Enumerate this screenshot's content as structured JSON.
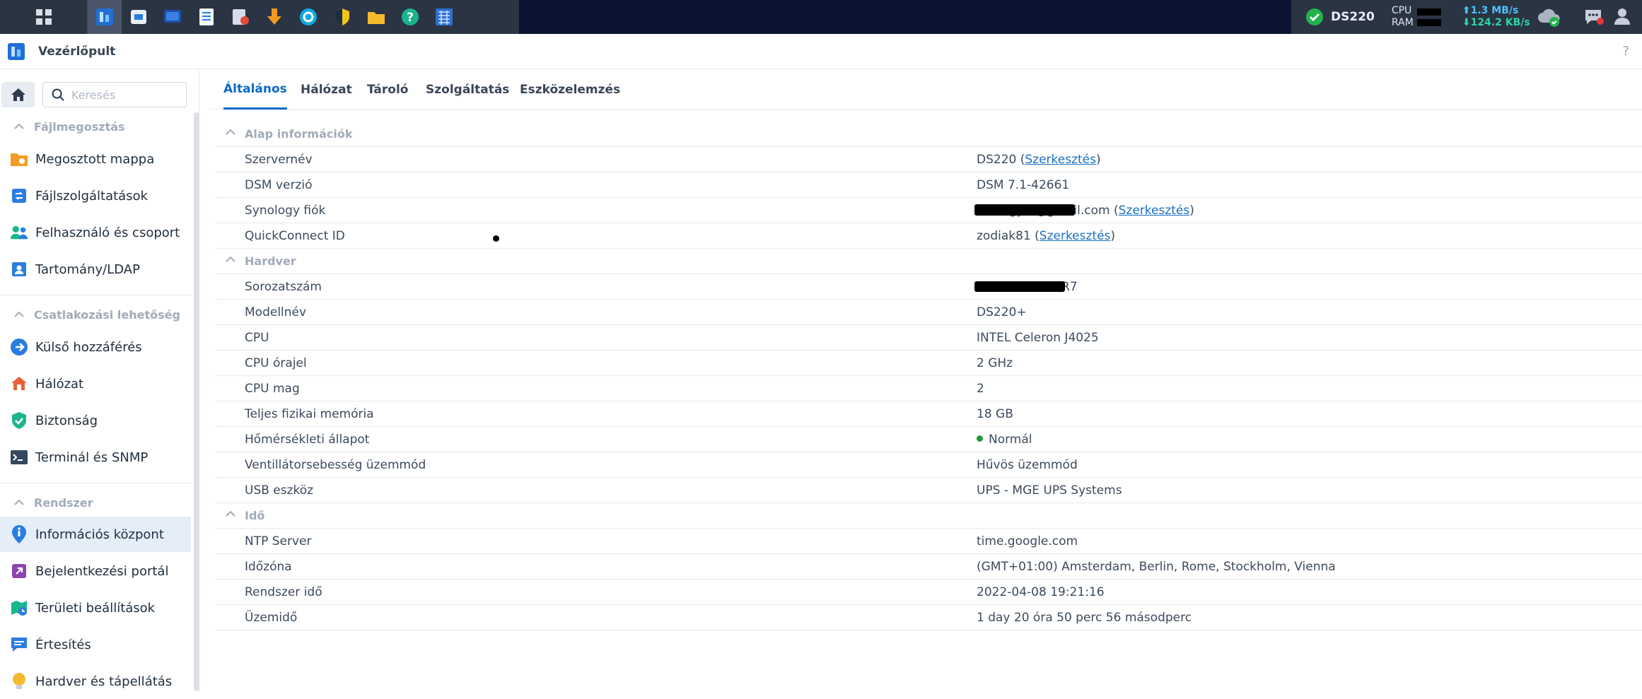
{
  "taskbar": {
    "status_name": "DS220",
    "cpu_label": "CPU",
    "ram_label": "RAM",
    "upload": "1.3 MB/s",
    "download": "124.2 KB/s"
  },
  "window": {
    "title": "Vezérlőpult",
    "help": "?"
  },
  "sidebar": {
    "search_placeholder": "Keresés",
    "sections": [
      {
        "label": "Fájlmegosztás"
      },
      {
        "label": "Csatlakozási lehetőség"
      },
      {
        "label": "Rendszer"
      }
    ],
    "items": [
      {
        "label": "Megosztott mappa"
      },
      {
        "label": "Fájlszolgáltatások"
      },
      {
        "label": "Felhasználó és csoport"
      },
      {
        "label": "Tartomány/LDAP"
      },
      {
        "label": "Külső hozzáférés"
      },
      {
        "label": "Hálózat"
      },
      {
        "label": "Biztonság"
      },
      {
        "label": "Terminál és SNMP"
      },
      {
        "label": "Információs központ"
      },
      {
        "label": "Bejelentkezési portál"
      },
      {
        "label": "Területi beállítások"
      },
      {
        "label": "Értesítés"
      },
      {
        "label": "Hardver és tápellátás"
      }
    ]
  },
  "tabs": [
    {
      "label": "Általános"
    },
    {
      "label": "Hálózat"
    },
    {
      "label": "Tároló"
    },
    {
      "label": "Szolgáltatás"
    },
    {
      "label": "Eszközelemzés"
    }
  ],
  "groups": {
    "basic": "Alap információk",
    "hardware": "Hardver",
    "time": "Idő"
  },
  "rows": {
    "server_name": {
      "key": "Szervernév",
      "value": "DS220 (",
      "link": "Szerkesztés",
      "tail": ")"
    },
    "dsm_version": {
      "key": "DSM verzió",
      "value": "DSM 7.1-42661"
    },
    "synology_account": {
      "key": "Synology fiók",
      "value": "gyo   @gmail.com (",
      "link": "Szerkesztés",
      "tail": ")"
    },
    "quickconnect": {
      "key": "QuickConnect ID",
      "value": "zodiak81 (",
      "link": "Szerkesztés",
      "tail": ")"
    },
    "serial": {
      "key": "Sorozatszám",
      "value": "R7"
    },
    "model": {
      "key": "Modellnév",
      "value": "DS220+"
    },
    "cpu": {
      "key": "CPU",
      "value": "INTEL Celeron J4025"
    },
    "cpu_clock": {
      "key": "CPU órajel",
      "value": "2 GHz"
    },
    "cpu_cores": {
      "key": "CPU mag",
      "value": "2"
    },
    "memory": {
      "key": "Teljes fizikai memória",
      "value": "18 GB"
    },
    "temp": {
      "key": "Hőmérsékleti állapot",
      "value": "Normál"
    },
    "fan": {
      "key": "Ventillátorsebesség üzemmód",
      "value": "Hűvös üzemmód"
    },
    "usb": {
      "key": "USB eszköz",
      "value": "UPS - MGE UPS Systems"
    },
    "ntp": {
      "key": "NTP Server",
      "value": "time.google.com"
    },
    "timezone": {
      "key": "Időzóna",
      "value": "(GMT+01:00) Amsterdam, Berlin, Rome, Stockholm, Vienna"
    },
    "system_time": {
      "key": "Rendszer idő",
      "value": "2022-04-08 19:21:16"
    },
    "uptime": {
      "key": "Üzemidő",
      "value": "1 day 20 óra 50 perc 56 másodperc"
    }
  }
}
